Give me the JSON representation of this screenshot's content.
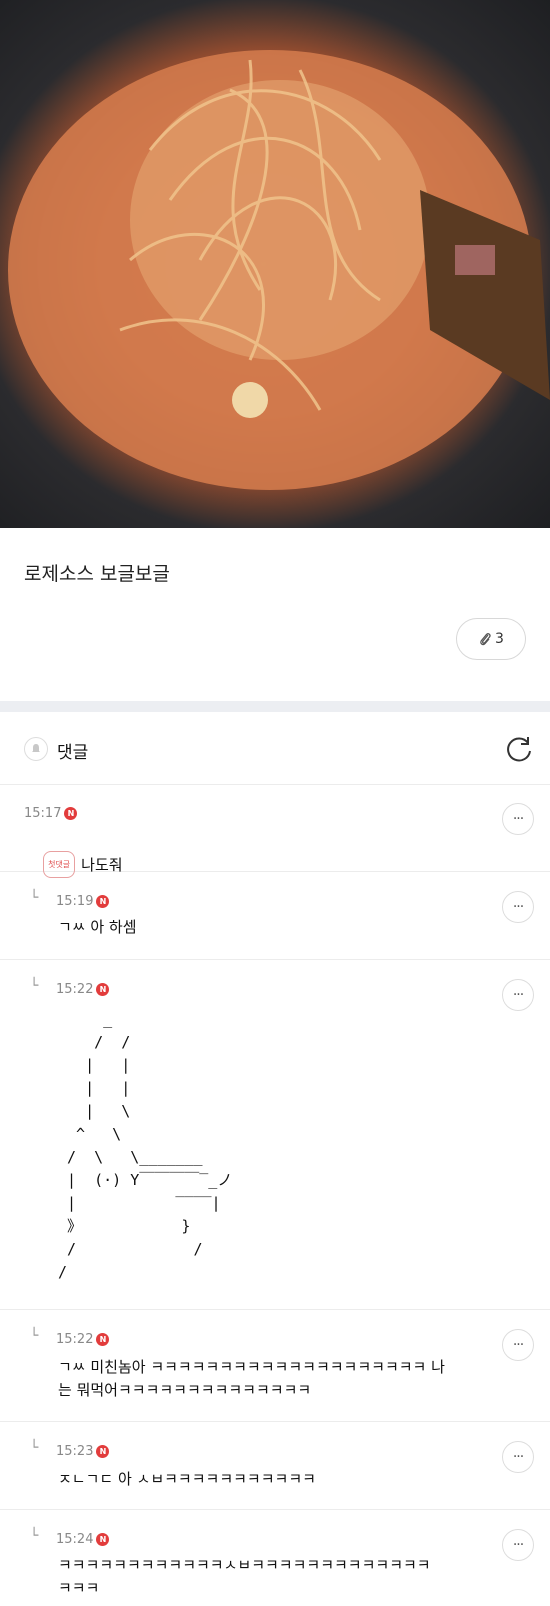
{
  "post": {
    "photo_alt_icon": "pasta-photo",
    "title": "로제소스 보글보글",
    "attachment_count": "3"
  },
  "comments_header": {
    "title": "댓글"
  },
  "comments": [
    {
      "time": "15:17",
      "badge": "N",
      "first_label": "첫댓글",
      "text": "나도줘"
    },
    {
      "time": "15:19",
      "badge": "N",
      "text": "ㄱㅆ 아 하셈"
    },
    {
      "time": "15:22",
      "badge": "N",
      "ascii": "     _\n    /  /\n   |   |\n   |   |\n   |   \\\n  ^   \\\n /  \\   \\_______\n |  (·) Y￣￣￣￣‾_ノ\n |           ‾‾‾‾|\n 》           }\n /             /\n/"
    },
    {
      "time": "15:22",
      "badge": "N",
      "text": "ㄱㅆ 미친놈아 ㅋㅋㅋㅋㅋㅋㅋㅋㅋㅋㅋㅋㅋㅋㅋㅋㅋㅋㅋㅋ 나\n는 뭐먹어ㅋㅋㅋㅋㅋㅋㅋㅋㅋㅋㅋㅋㅋㅋ"
    },
    {
      "time": "15:23",
      "badge": "N",
      "text": "ㅈㄴㄱㄷ 아 ㅅㅂㅋㅋㅋㅋㅋㅋㅋㅋㅋㅋㅋ"
    },
    {
      "time": "15:24",
      "badge": "N",
      "text": "ㅋㅋㅋㅋㅋㅋㅋㅋㅋㅋㅋㅋㅅㅂㅋㅋㅋㅋㅋㅋㅋㅋㅋㅋㅋㅋㅋ\nㅋㅋㅋ"
    }
  ],
  "more_label": "···"
}
